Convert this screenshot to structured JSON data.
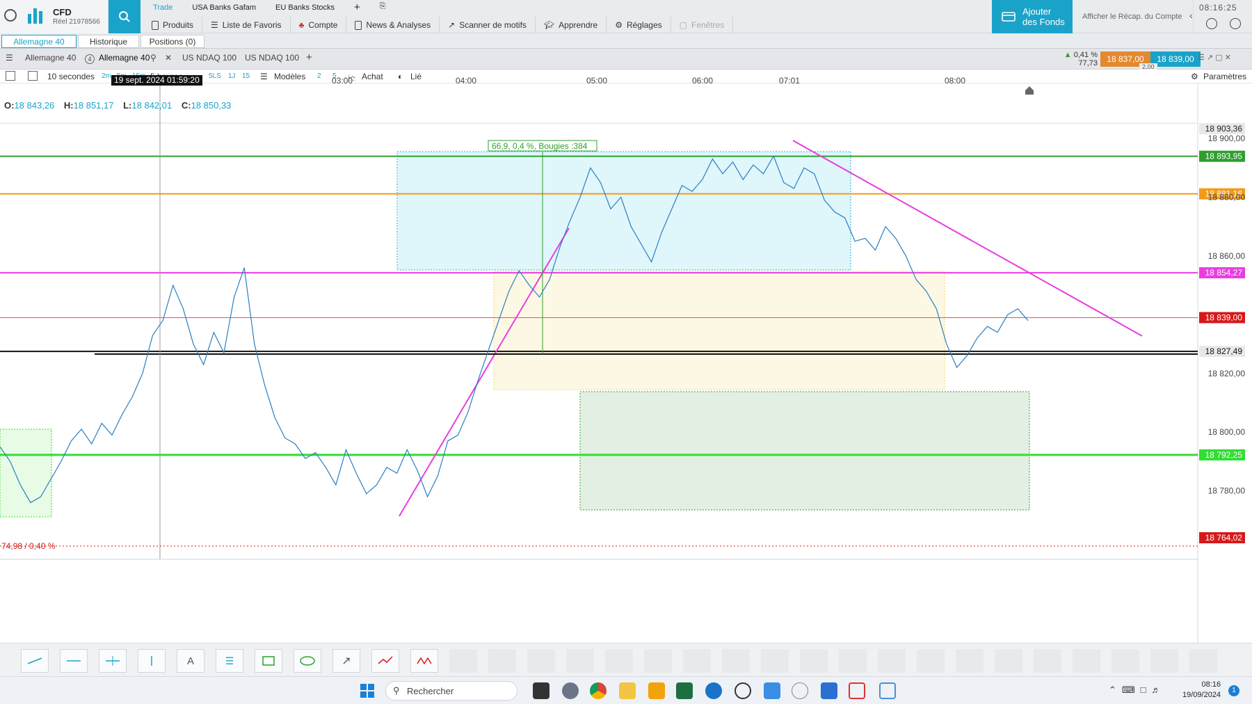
{
  "brand": {
    "name": "CFD",
    "account": "Réel 21978566"
  },
  "top_tabs": [
    "Trade",
    "USA Banks Gafam",
    "EU Banks Stocks"
  ],
  "menu": [
    {
      "label": "Produits",
      "icon": "document-icon"
    },
    {
      "label": "Liste de Favoris",
      "icon": "list-icon"
    },
    {
      "label": "Compte",
      "icon": "wallet-icon"
    },
    {
      "label": "News & Analyses",
      "icon": "news-icon"
    },
    {
      "label": "Scanner de motifs",
      "icon": "scanner-icon"
    },
    {
      "label": "Apprendre",
      "icon": "graduation-icon"
    },
    {
      "label": "Réglages",
      "icon": "gear-icon"
    },
    {
      "label": "Fenêtres",
      "icon": "window-icon"
    }
  ],
  "fund_button": {
    "line1": "Ajouter",
    "line2": "des Fonds"
  },
  "recap": "Afficher le Récap. du Compte",
  "clock": "08:16:25",
  "subtabs": [
    "Allemagne 40",
    "Historique",
    "Positions (0)"
  ],
  "chart_tabs": {
    "first": "Allemagne 40",
    "active_badge": "4",
    "active": "Allemagne 40",
    "others": [
      "US NDAQ 100",
      "US NDAQ 100"
    ]
  },
  "quote": {
    "change_pct": "0,41 %",
    "change_abs": "77,73",
    "bid": "18 837,00",
    "ask": "18 839,00",
    "spread": "2,00"
  },
  "toolbar": {
    "interval": "10 secondes",
    "quick_intervals": [
      "2m",
      "5m",
      "15m"
    ],
    "range": "5 heures",
    "quick_ranges": [
      "5LS",
      "1J",
      "15"
    ],
    "models": "Modèles",
    "nums": [
      "2",
      "5"
    ],
    "buy": "Achat",
    "link": "Lié",
    "params": "Paramètres"
  },
  "chart_header": {
    "cursor_time": "19 sept. 2024 01:59:20",
    "o_label": "O:",
    "o": "18 843,26",
    "h_label": "H:",
    "h": "18 851,17",
    "l_label": "L:",
    "l": "18 842,01",
    "c_label": "C:",
    "c": "18 850,33"
  },
  "measure_label": "66,9, 0,4 %, Bougies :384",
  "bottom_left_label": "74,98 / 0,40 %",
  "colors": {
    "accent": "#1aa3c9",
    "green_line": "#2e9e2e",
    "orange_line": "#f29a1a",
    "magenta_line": "#e83ee0",
    "red_line": "#d9534f",
    "lime_line": "#33dd33",
    "price_tag_red": "#d51a1a"
  },
  "chart_data": {
    "type": "line",
    "symbol": "Allemagne 40",
    "x_ticks": [
      "03:00",
      "04:00",
      "05:00",
      "06:00",
      "07:01",
      "08:00"
    ],
    "y_ticks": [
      "18 900,00",
      "18 880,00",
      "18 860,00",
      "18 820,00",
      "18 800,00",
      "18 780,00"
    ],
    "ylim": [
      18760,
      18905
    ],
    "price_tags": [
      {
        "value": "18 903,36",
        "style": "grey"
      },
      {
        "value": "18 893,95",
        "style": "green"
      },
      {
        "value": "18 881,16",
        "style": "orange"
      },
      {
        "value": "18 854,27",
        "style": "magenta"
      },
      {
        "value": "18 839,00",
        "style": "red"
      },
      {
        "value": "18 827,49",
        "style": "black"
      },
      {
        "value": "18 792,25",
        "style": "lime"
      },
      {
        "value": "18 764,02",
        "style": "red"
      }
    ],
    "horizontal_lines": [
      {
        "y": 18893.95,
        "color": "#2e9e2e"
      },
      {
        "y": 18881.16,
        "color": "#f29a1a"
      },
      {
        "y": 18854.27,
        "color": "#e83ee0"
      },
      {
        "y": 18839.0,
        "color": "#d9534f"
      },
      {
        "y": 18827.49,
        "color": "#111111"
      },
      {
        "y": 18792.25,
        "color": "#33dd33"
      }
    ],
    "series": [
      {
        "values": [
          18795,
          18790,
          18782,
          18776,
          18778,
          18784,
          18790,
          18797,
          18801,
          18796,
          18803,
          18799,
          18806,
          18812,
          18820,
          18833,
          18838,
          18850,
          18842,
          18830,
          18823,
          18834,
          18827,
          18846,
          18856,
          18830,
          18816,
          18805,
          18798,
          18796,
          18791,
          18793,
          18788,
          18782,
          18794,
          18786,
          18779,
          18782,
          18788,
          18786,
          18794,
          18787,
          18778,
          18785,
          18797,
          18799,
          18807,
          18818,
          18828,
          18838,
          18848,
          18855,
          18850,
          18846,
          18852,
          18863,
          18872,
          18880,
          18890,
          18885,
          18876,
          18880,
          18870,
          18864,
          18858,
          18868,
          18876,
          18884,
          18882,
          18886,
          18893,
          18888,
          18892,
          18886,
          18891,
          18888,
          18894,
          18885,
          18883,
          18890,
          18888,
          18879,
          18875,
          18873,
          18865,
          18866,
          18862,
          18870,
          18866,
          18860,
          18852,
          18848,
          18842,
          18830,
          18822,
          18826,
          18832,
          18836,
          18834,
          18840,
          18842,
          18838
        ]
      }
    ]
  },
  "taskbar": {
    "search_placeholder": "Rechercher",
    "time": "08:16",
    "date": "19/09/2024",
    "notif": "1"
  }
}
